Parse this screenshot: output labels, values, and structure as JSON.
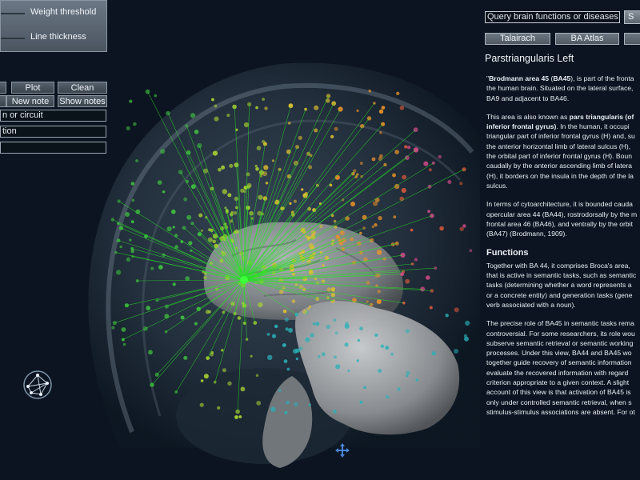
{
  "controls": {
    "weight_threshold_label": "Weight threshold",
    "line_thickness_label": "Line thickness",
    "weight_threshold_value": 0.05,
    "line_thickness_value": 0.05,
    "buttons": {
      "plot": "Plot",
      "clean": "Clean",
      "new_note": "New note",
      "show_notes": "Show notes"
    },
    "fields": {
      "circuit": "n or circuit",
      "function": "tion",
      "extra": ""
    }
  },
  "panel": {
    "search_placeholder": "Query brain functions or diseases",
    "search_button": "S",
    "tabs": [
      "Talairach",
      "BA Atlas"
    ],
    "region_title": "Parstriangularis Left",
    "p1": [
      {
        "segments": [
          {
            "t": "\"",
            "b": false
          },
          {
            "t": "Brodmann area 45",
            "b": true
          },
          {
            "t": " (",
            "b": false
          },
          {
            "t": "BA45",
            "b": true
          },
          {
            "t": "), is part of the fronta",
            "b": false
          }
        ]
      },
      {
        "segments": [
          {
            "t": "the human brain. Situated on the lateral surface,",
            "b": false
          }
        ]
      },
      {
        "segments": [
          {
            "t": "BA9 and adjacent to BA46.",
            "b": false
          }
        ]
      }
    ],
    "p2": [
      {
        "segments": [
          {
            "t": "This area is also known as ",
            "b": false
          },
          {
            "t": "pars triangularis (of",
            "b": true
          }
        ]
      },
      {
        "segments": [
          {
            "t": "inferior frontal gyrus)",
            "b": true
          },
          {
            "t": ". In the human, it occupi",
            "b": false
          }
        ]
      },
      {
        "segments": [
          {
            "t": "triangular part of inferior frontal gyrus (H) and, su",
            "b": false
          }
        ]
      },
      {
        "segments": [
          {
            "t": "the anterior horizontal limb of lateral sulcus (H),",
            "b": false
          }
        ]
      },
      {
        "segments": [
          {
            "t": "the orbital part of inferior frontal gyrus (H). Boun",
            "b": false
          }
        ]
      },
      {
        "segments": [
          {
            "t": "caudally by the anterior ascending limb of latera",
            "b": false
          }
        ]
      },
      {
        "segments": [
          {
            "t": "(H), it borders on the insula in the depth of the la",
            "b": false
          }
        ]
      },
      {
        "segments": [
          {
            "t": "sulcus.",
            "b": false
          }
        ]
      }
    ],
    "p3": [
      {
        "segments": [
          {
            "t": "In terms of cytoarchitecture, it is bounded cauda",
            "b": false
          }
        ]
      },
      {
        "segments": [
          {
            "t": "opercular area 44 (BA44), rostrodorsally by the m",
            "b": false
          }
        ]
      },
      {
        "segments": [
          {
            "t": "frontal area 46 (BA46), and ventrally by the orbit",
            "b": false
          }
        ]
      },
      {
        "segments": [
          {
            "t": "(BA47) (Brodmann, 1909).",
            "b": false
          }
        ]
      }
    ],
    "functions_heading": "Functions",
    "p4": [
      {
        "segments": [
          {
            "t": "Together with BA 44, it comprises Broca's area,",
            "b": false
          }
        ]
      },
      {
        "segments": [
          {
            "t": "that is active in semantic tasks, such as semantic",
            "b": false
          }
        ]
      },
      {
        "segments": [
          {
            "t": "tasks (determining whether a word represents a",
            "b": false
          }
        ]
      },
      {
        "segments": [
          {
            "t": "or a concrete entity) and generation tasks (gene",
            "b": false
          }
        ]
      },
      {
        "segments": [
          {
            "t": "verb associated with a noun).",
            "b": false
          }
        ]
      }
    ],
    "p5": [
      {
        "segments": [
          {
            "t": "The precise role of BA45 in semantic tasks rema",
            "b": false
          }
        ]
      },
      {
        "segments": [
          {
            "t": "controversial. For some researchers, its role wou",
            "b": false
          }
        ]
      },
      {
        "segments": [
          {
            "t": "subserve semantic retrieval or semantic working",
            "b": false
          }
        ]
      },
      {
        "segments": [
          {
            "t": "processes. Under this view, BA44 and BA45 wo",
            "b": false
          }
        ]
      },
      {
        "segments": [
          {
            "t": "together guide recovery of semantic information",
            "b": false
          }
        ]
      },
      {
        "segments": [
          {
            "t": "evaluate the recovered information with regard",
            "b": false
          }
        ]
      },
      {
        "segments": [
          {
            "t": "criterion appropriate to a given context. A slight",
            "b": false
          }
        ]
      },
      {
        "segments": [
          {
            "t": "account of this view is that activation of BA45 is",
            "b": false
          }
        ]
      },
      {
        "segments": [
          {
            "t": "only under controlled semantic retrieval, when s",
            "b": false
          }
        ]
      },
      {
        "segments": [
          {
            "t": "stimulus-stimulus associations are absent. For ot",
            "b": false
          }
        ]
      }
    ]
  },
  "icons": {
    "logo": "network-logo-icon",
    "move": "move-cross-icon"
  },
  "colors": {
    "background": "#0b1420",
    "connection": "#28e028",
    "node_palette": [
      "#3fbf3f",
      "#a8d232",
      "#e0c030",
      "#e8902a",
      "#e05a3a",
      "#d44a8a",
      "#2ab0b8"
    ]
  }
}
